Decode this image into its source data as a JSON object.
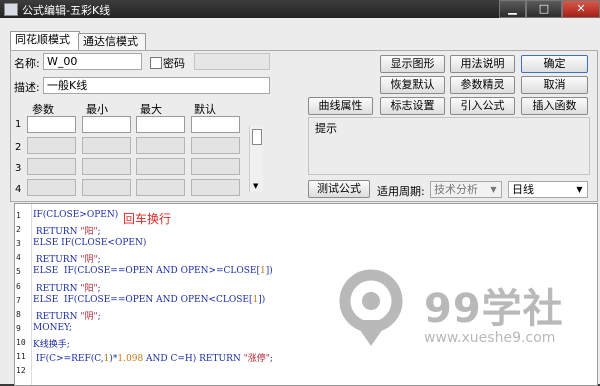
{
  "window": {
    "title": "公式编辑-五彩K线"
  },
  "tabs": [
    {
      "label": "同花顺模式"
    },
    {
      "label": "通达信模式"
    }
  ],
  "form": {
    "name_label": "名称:",
    "name_value": "W_00",
    "password_label": "密码",
    "desc_label": "描述:",
    "desc_value": "一般K线"
  },
  "params": {
    "headers": [
      "参数",
      "最小",
      "最大",
      "默认"
    ],
    "rows": [
      "1",
      "2",
      "3",
      "4"
    ]
  },
  "buttons": {
    "show_graph": "显示图形",
    "usage": "用法说明",
    "ok": "确定",
    "restore_default": "恢复默认",
    "param_tuning": "参数精灵",
    "cancel": "取消",
    "curve_attr": "曲线属性",
    "mark_settings": "标志设置",
    "import_formula": "引入公式",
    "insert_func": "插入函数",
    "test_formula": "测试公式"
  },
  "hint_label": "提示",
  "period": {
    "label": "适用周期:",
    "analysis": "技术分析",
    "value": "日线"
  },
  "editor": {
    "overlay_note": "回车换行",
    "line_numbers": [
      "1",
      "2",
      "3",
      "4",
      "5",
      "6",
      "7",
      "8",
      "9",
      "10",
      "11",
      "12"
    ],
    "lines": [
      [
        {
          "t": "IF(CLOSE>OPEN)",
          "c": ""
        }
      ],
      [
        {
          "t": " RETURN ",
          "c": ""
        },
        {
          "t": "\"阳\"",
          "c": "str"
        },
        {
          "t": ";",
          "c": ""
        }
      ],
      [
        {
          "t": "ELSE IF(CLOSE<OPEN)",
          "c": ""
        }
      ],
      [
        {
          "t": " RETURN ",
          "c": ""
        },
        {
          "t": "\"阴\"",
          "c": "str"
        },
        {
          "t": ";",
          "c": ""
        }
      ],
      [
        {
          "t": "ELSE  IF(CLOSE==OPEN AND OPEN>=CLOSE[",
          "c": ""
        },
        {
          "t": "1",
          "c": "num"
        },
        {
          "t": "])",
          "c": ""
        }
      ],
      [
        {
          "t": " RETURN ",
          "c": ""
        },
        {
          "t": "\"阳\"",
          "c": "str"
        },
        {
          "t": ";",
          "c": ""
        }
      ],
      [
        {
          "t": "ELSE  IF(CLOSE==OPEN AND OPEN<CLOSE[",
          "c": ""
        },
        {
          "t": "1",
          "c": "num"
        },
        {
          "t": "])",
          "c": ""
        }
      ],
      [
        {
          "t": " RETURN ",
          "c": ""
        },
        {
          "t": "\"阴\"",
          "c": "str"
        },
        {
          "t": ";",
          "c": ""
        }
      ],
      [
        {
          "t": "MONEY;",
          "c": ""
        }
      ],
      [
        {
          "t": "K线换手;",
          "c": ""
        }
      ],
      [
        {
          "t": " IF(C>=REF(C,",
          "c": ""
        },
        {
          "t": "1",
          "c": "num"
        },
        {
          "t": ")*",
          "c": ""
        },
        {
          "t": "1.098",
          "c": "num"
        },
        {
          "t": " AND C=H) RETURN ",
          "c": ""
        },
        {
          "t": "\"涨停\"",
          "c": "str"
        },
        {
          "t": ";",
          "c": ""
        }
      ],
      [
        {
          "t": "",
          "c": ""
        }
      ]
    ]
  },
  "watermark": {
    "brand": "99学社",
    "url": "www.xueshe9.com"
  },
  "colors": {
    "editor_text": "#1c2fa8",
    "string": "#b0263a",
    "number": "#c07a13",
    "note": "#e22828"
  }
}
